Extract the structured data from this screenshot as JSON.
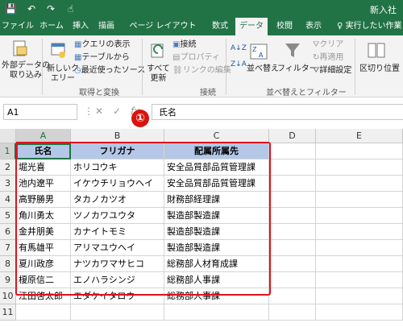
{
  "titlebar": {
    "title": "新入社",
    "qa_save": "💾",
    "qa_undo": "↶",
    "qa_redo": "↷",
    "qa_touch": "☝"
  },
  "tabs": [
    "ファイル",
    "ホーム",
    "挿入",
    "描画",
    "ページ レイアウト",
    "数式",
    "データ",
    "校閲",
    "表示"
  ],
  "active_tab": "データ",
  "tell_me": "実行したい作業",
  "ribbon": {
    "get_external": "外部データの\n取り込み",
    "new_query": "新しいク\nエリー",
    "show_queries": "クエリの表示",
    "from_table": "テーブルから",
    "recent_sources": "最近使ったソース",
    "group_get": "取得と変換",
    "refresh_all": "すべて\n更新",
    "connections": "接続",
    "properties": "プロパティ",
    "edit_links": "リンクの編集",
    "group_connections": "接続",
    "sort_asc": "A↓Z",
    "sort_desc": "Z↓A",
    "sort": "並べ替え",
    "filter": "フィルター",
    "clear": "クリア",
    "reapply": "再適用",
    "advanced": "詳細設定",
    "group_sort": "並べ替えとフィルター",
    "text_to_columns": "区切り位置"
  },
  "namebox": "A1",
  "formula": "氏名",
  "fx": "fx",
  "marker": "①",
  "columns": [
    "A",
    "B",
    "C",
    "D",
    "E"
  ],
  "rows": [
    "1",
    "2",
    "3",
    "4",
    "5",
    "6",
    "7",
    "8",
    "9",
    "10",
    "11"
  ],
  "table": {
    "headers": [
      "氏名",
      "フリガナ",
      "配属所属先"
    ],
    "rows": [
      [
        "堀光喜",
        "ホリコウキ",
        "安全品質部品質管理課"
      ],
      [
        "池内遼平",
        "イケウチリョウヘイ",
        "安全品質部品質管理課"
      ],
      [
        "高野勝男",
        "タカノカツオ",
        "財務部経理課"
      ],
      [
        "角川勇太",
        "ツノカワユウタ",
        "製造部製造課"
      ],
      [
        "金井朋美",
        "カナイトモミ",
        "製造部製造課"
      ],
      [
        "有馬雄平",
        "アリマユウヘイ",
        "製造部製造課"
      ],
      [
        "夏川政彦",
        "ナツカワマサヒコ",
        "総務部人材育成課"
      ],
      [
        "榎原信二",
        "エノハラシンジ",
        "総務部人事課"
      ],
      [
        "江田啓太郎",
        "エダケイタロウ",
        "総務部人事課"
      ]
    ]
  },
  "colors": {
    "excel_green": "#217346",
    "header_fill": "#b4c7e7",
    "highlight": "#e0111c"
  }
}
